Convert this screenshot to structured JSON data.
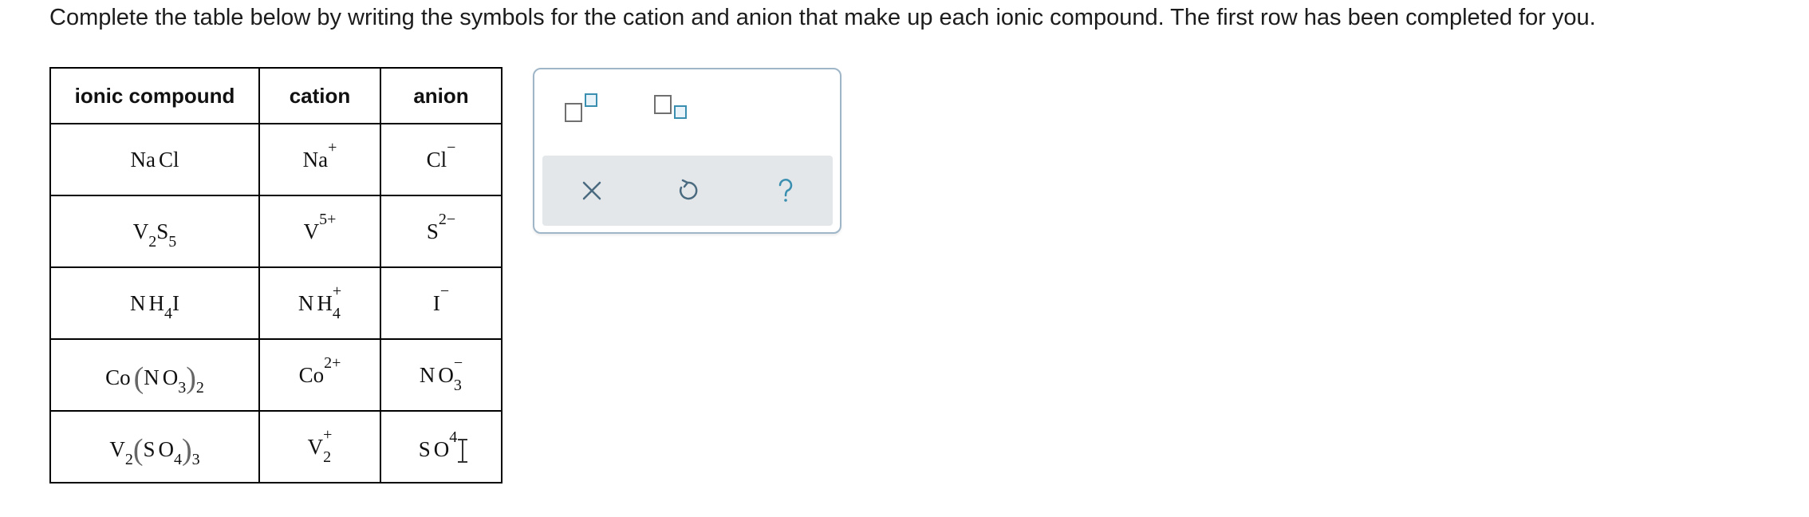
{
  "prompt": "Complete the table below by writing the symbols for the cation and anion that make up each ionic compound. The first row has been completed for you.",
  "table": {
    "headers": [
      "ionic compound",
      "cation",
      "anion"
    ],
    "rows": [
      {
        "compound": {
          "a": "Na",
          "b": "Cl"
        },
        "cation": {
          "base": "Na",
          "charge": "+"
        },
        "anion": {
          "base": "Cl",
          "charge": "−"
        }
      },
      {
        "compound": {
          "a": "V",
          "a_sub": "2",
          "b": "S",
          "b_sub": "5"
        },
        "cation": {
          "base": "V",
          "charge": "5+"
        },
        "anion": {
          "base": "S",
          "charge": "2−"
        }
      },
      {
        "compound": {
          "a": "N",
          "b": "H",
          "b_sub": "4",
          "c": "I"
        },
        "cation": {
          "a": "N",
          "b": "H",
          "sub": "4",
          "charge": "+"
        },
        "anion": {
          "base": "I",
          "charge": "−"
        }
      },
      {
        "compound": {
          "a": "Co",
          "open": "(",
          "b": "N",
          "c": "O",
          "c_sub": "3",
          "close": ")",
          "outer_sub": "2"
        },
        "cation": {
          "base": "Co",
          "charge": "2+"
        },
        "anion": {
          "a": "N",
          "b": "O",
          "sub": "3",
          "charge": "−"
        }
      },
      {
        "compound": {
          "a": "V",
          "a_sub": "2",
          "open": "(",
          "b": "S",
          "c": "O",
          "c_sub": "4",
          "close": ")",
          "outer_sub": "3"
        },
        "cation": {
          "base": "V",
          "sub": "2",
          "charge": "+"
        },
        "anion": {
          "a": "S",
          "b": "O",
          "charge": "4"
        }
      }
    ]
  },
  "palette": {
    "templates": [
      "superscript-template-icon",
      "subscript-template-icon"
    ],
    "actions": {
      "clear": "×",
      "undo": "undo-icon",
      "help": "?"
    },
    "colors": {
      "accent": "#3a8fb0",
      "border": "#9fb6c8",
      "bar": "#e3e7ea"
    }
  }
}
